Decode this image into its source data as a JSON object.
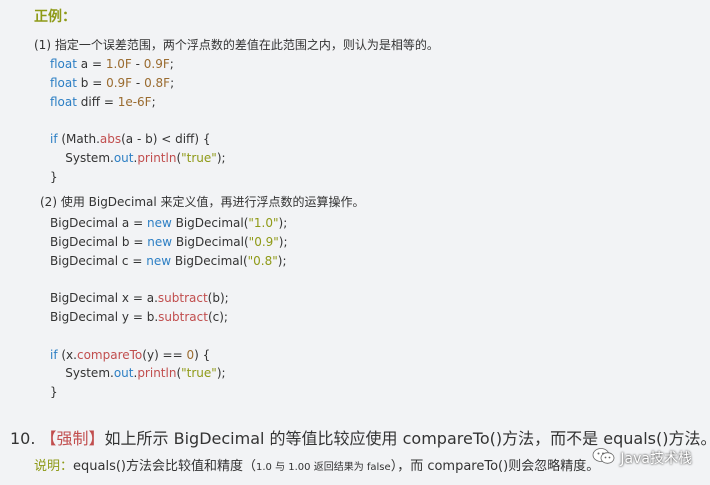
{
  "example_label": "正例：",
  "section1": {
    "title": "(1) 指定一个误差范围，两个浮点数的差值在此范围之内，则认为是相等的。",
    "lines": [
      {
        "parts": [
          {
            "t": "float",
            "c": "kw"
          },
          {
            "t": " a = ",
            "c": ""
          },
          {
            "t": "1.0F",
            "c": "num"
          },
          {
            "t": " - ",
            "c": ""
          },
          {
            "t": "0.9F",
            "c": "num"
          },
          {
            "t": ";",
            "c": ""
          }
        ]
      },
      {
        "parts": [
          {
            "t": "float",
            "c": "kw"
          },
          {
            "t": " b = ",
            "c": ""
          },
          {
            "t": "0.9F",
            "c": "num"
          },
          {
            "t": " - ",
            "c": ""
          },
          {
            "t": "0.8F",
            "c": "num"
          },
          {
            "t": ";",
            "c": ""
          }
        ]
      },
      {
        "parts": [
          {
            "t": "float",
            "c": "kw"
          },
          {
            "t": " diff = ",
            "c": ""
          },
          {
            "t": "1e-6F",
            "c": "num"
          },
          {
            "t": ";",
            "c": ""
          }
        ]
      },
      {
        "parts": []
      },
      {
        "parts": [
          {
            "t": "if",
            "c": "kw"
          },
          {
            "t": " (Math.",
            "c": ""
          },
          {
            "t": "abs",
            "c": "fn"
          },
          {
            "t": "(a - b) < diff) {",
            "c": ""
          }
        ]
      },
      {
        "parts": [
          {
            "t": "    System.",
            "c": ""
          },
          {
            "t": "out",
            "c": "kw"
          },
          {
            "t": ".",
            "c": ""
          },
          {
            "t": "println",
            "c": "fn"
          },
          {
            "t": "(",
            "c": ""
          },
          {
            "t": "\"true\"",
            "c": "str"
          },
          {
            "t": ");",
            "c": ""
          }
        ]
      },
      {
        "parts": [
          {
            "t": "}",
            "c": ""
          }
        ]
      }
    ]
  },
  "section2": {
    "title": "(2) 使用 BigDecimal 来定义值，再进行浮点数的运算操作。",
    "lines": [
      {
        "parts": [
          {
            "t": "BigDecimal a = ",
            "c": ""
          },
          {
            "t": "new",
            "c": "kw"
          },
          {
            "t": " BigDecimal(",
            "c": ""
          },
          {
            "t": "\"1.0\"",
            "c": "str"
          },
          {
            "t": ");",
            "c": ""
          }
        ]
      },
      {
        "parts": [
          {
            "t": "BigDecimal b = ",
            "c": ""
          },
          {
            "t": "new",
            "c": "kw"
          },
          {
            "t": " BigDecimal(",
            "c": ""
          },
          {
            "t": "\"0.9\"",
            "c": "str"
          },
          {
            "t": ");",
            "c": ""
          }
        ]
      },
      {
        "parts": [
          {
            "t": "BigDecimal c = ",
            "c": ""
          },
          {
            "t": "new",
            "c": "kw"
          },
          {
            "t": " BigDecimal(",
            "c": ""
          },
          {
            "t": "\"0.8\"",
            "c": "str"
          },
          {
            "t": ");",
            "c": ""
          }
        ]
      },
      {
        "parts": []
      },
      {
        "parts": [
          {
            "t": "BigDecimal x = a.",
            "c": ""
          },
          {
            "t": "subtract",
            "c": "fn"
          },
          {
            "t": "(b);",
            "c": ""
          }
        ]
      },
      {
        "parts": [
          {
            "t": "BigDecimal y = b.",
            "c": ""
          },
          {
            "t": "subtract",
            "c": "fn"
          },
          {
            "t": "(c);",
            "c": ""
          }
        ]
      },
      {
        "parts": []
      },
      {
        "parts": [
          {
            "t": "if",
            "c": "kw"
          },
          {
            "t": " (x.",
            "c": ""
          },
          {
            "t": "compareTo",
            "c": "fn"
          },
          {
            "t": "(y) == ",
            "c": ""
          },
          {
            "t": "0",
            "c": "num"
          },
          {
            "t": ") {",
            "c": ""
          }
        ]
      },
      {
        "parts": [
          {
            "t": "    System.",
            "c": ""
          },
          {
            "t": "out",
            "c": "kw"
          },
          {
            "t": ".",
            "c": ""
          },
          {
            "t": "println",
            "c": "fn"
          },
          {
            "t": "(",
            "c": ""
          },
          {
            "t": "\"true\"",
            "c": "str"
          },
          {
            "t": ");",
            "c": ""
          }
        ]
      },
      {
        "parts": [
          {
            "t": "}",
            "c": ""
          }
        ]
      }
    ]
  },
  "item10": {
    "number": "10. ",
    "tag": "【强制】",
    "text": "如上所示 BigDecimal 的等值比较应使用 compareTo()方法，而不是 equals()方法。"
  },
  "note": {
    "label": "说明：",
    "text_before": "equals()方法会比较值和精度（",
    "small": "1.0 与 1.00 返回结果为 false",
    "text_after": "），而 compareTo()则会忽略精度。"
  },
  "watermark": {
    "icon": "wechat-icon",
    "text": "Java技术栈"
  }
}
